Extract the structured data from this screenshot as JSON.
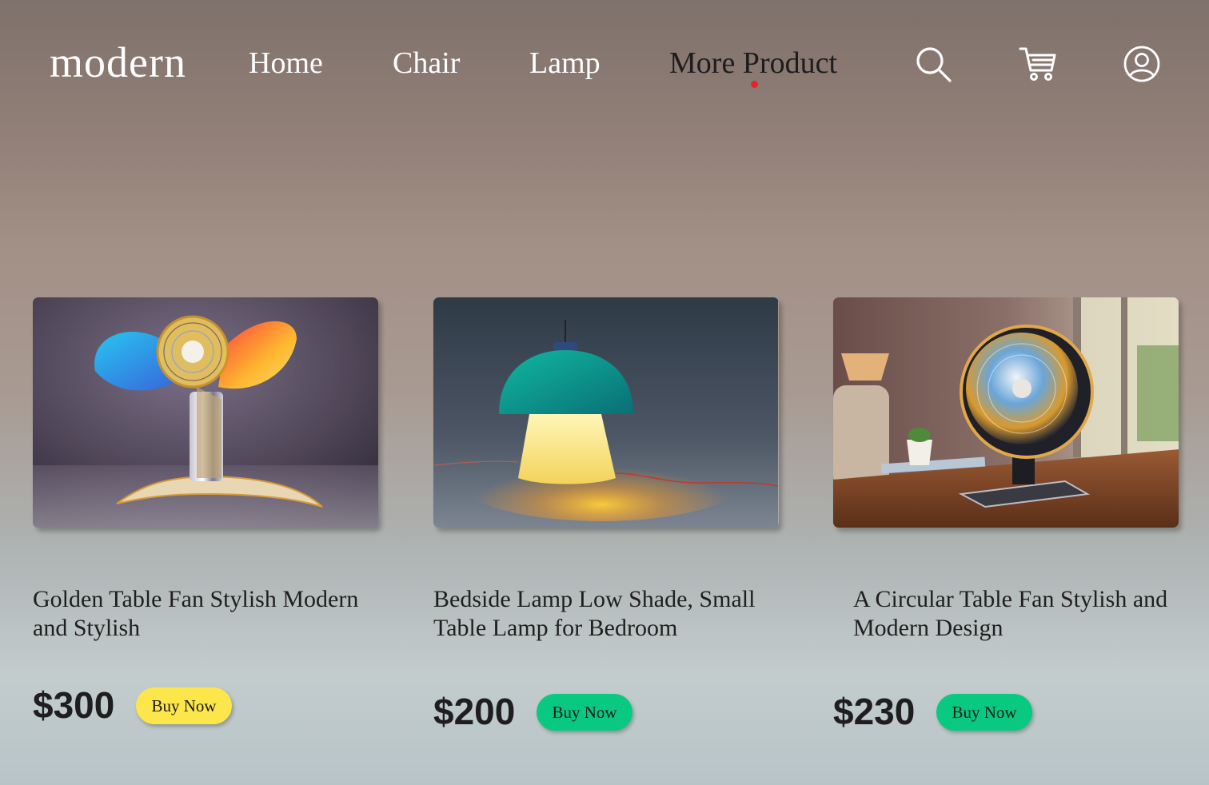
{
  "header": {
    "logo": "modern",
    "nav": [
      {
        "label": "Home",
        "active": false
      },
      {
        "label": "Chair",
        "active": false
      },
      {
        "label": "Lamp",
        "active": false
      },
      {
        "label": "More Product",
        "active": true
      }
    ],
    "icons": [
      "search-icon",
      "cart-icon",
      "user-icon"
    ],
    "active_indicator_color": "#e0262b"
  },
  "products": [
    {
      "title": "Golden Table Fan Stylish Modern and Stylish",
      "price": "$300",
      "button": "Buy Now",
      "button_color": "#fde649",
      "image": "colorful-table-fan"
    },
    {
      "title": "Bedside Lamp  Low Shade, Small Table Lamp for Bedroom",
      "price": "$200",
      "button": "Buy Now",
      "button_color": "#08c97f",
      "image": "teal-mushroom-lamp"
    },
    {
      "title": "A Circular Table Fan Stylish and Modern Design",
      "price": "$230",
      "button": "Buy Now",
      "button_color": "#08c97f",
      "image": "chrome-desk-fan"
    }
  ]
}
